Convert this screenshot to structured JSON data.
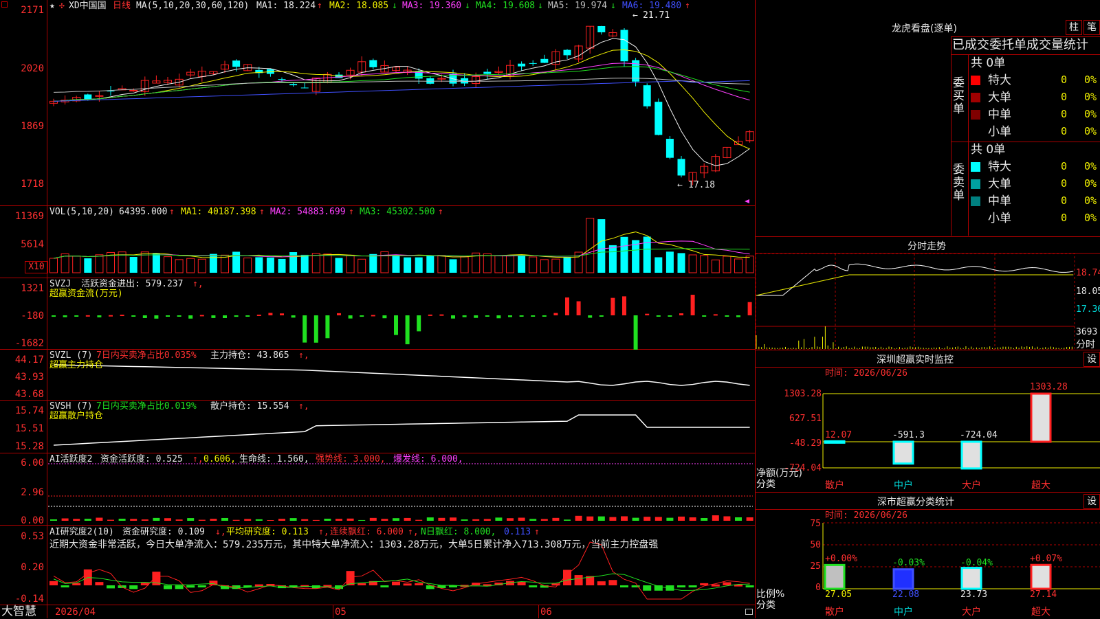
{
  "app_name": "大智慧",
  "main": {
    "header": {
      "star": "★",
      "cross": "✣",
      "stock": "XD中国国",
      "period": "日线",
      "ma_params": "MA(5,10,20,30,60,120)",
      "ma1": "MA1: 18.224",
      "ma1_arrow": "↑",
      "ma2": "MA2: 18.085",
      "ma2_arrow": "↓",
      "ma3": "MA3: 19.360",
      "ma3_arrow": "↓",
      "ma4": "MA4: 19.608",
      "ma4_arrow": "↓",
      "ma5": "MA5: 19.974",
      "ma5_arrow": "↓",
      "ma6": "MA6: 19.480",
      "ma6_arrow": "↑"
    },
    "price_ticks": [
      "2171",
      "2020",
      "1869",
      "1718"
    ],
    "high_label": "21.71",
    "low_label": "17.18",
    "low_arrow": "←",
    "high_arrow": "←"
  },
  "vol": {
    "header": "VOL(5,10,20)",
    "value": "64395.000",
    "ma1": "MA1: 40187.398",
    "ma2": "MA2: 54883.699",
    "ma3": "MA3: 45302.500",
    "ticks": [
      "11369",
      "5614"
    ],
    "unit": "X10"
  },
  "svzj": {
    "header": "SVZJ",
    "desc": "活跃资金进出: 579.237",
    "sub": "超赢资金流(万元)",
    "ticks": [
      "1321",
      "-180",
      "-1682"
    ]
  },
  "svzl": {
    "header": "SVZL (7)",
    "desc1": "7日内买卖净占比0.035%",
    "desc2": "主力持仓: 43.865",
    "sub": "超赢主力持仓",
    "ticks": [
      "44.17",
      "43.93",
      "43.68"
    ]
  },
  "svsh": {
    "header": "SVSH (7)",
    "desc1": "7日内买卖净占比0.019%",
    "desc2": "散户持仓: 15.554",
    "sub": "超赢散户持仓",
    "ticks": [
      "15.74",
      "15.51",
      "15.28"
    ]
  },
  "ai1": {
    "header": "AI活跃度2",
    "desc1": "资金活跃度: 0.525",
    "desc2": "0.606,",
    "desc3": "生命线: 1.560,",
    "desc4": "强势线: 3.000,",
    "desc5": "爆发线: 6.000,",
    "ticks": [
      "6.00",
      "2.96",
      "0.00"
    ]
  },
  "ai2": {
    "header": "AI研究度2(10)",
    "desc1": "资金研究度: 0.109",
    "desc2": "平均研究度: 0.113",
    "desc3": "连续飘红: 6.000",
    "desc4": "N日飘红: 8.000,",
    "desc5": "0.113",
    "comment": "近期大资金非常活跃，今日大单净流入：579.235万元，其中特大单净流入：1303.28万元，大单5日累计净入713.308万元，当前主力控盘强",
    "ticks": [
      "0.53",
      "0.20",
      "-0.14"
    ]
  },
  "x_axis": {
    "d1": "2026/04",
    "d2": "05",
    "d3": "06"
  },
  "right": {
    "lhb_title": "龙虎看盘(逐单)",
    "tab1": "柱",
    "tab2": "笔",
    "stats_title": "已成交委托单成交量统计",
    "buy_label": "委买单",
    "sell_label": "委卖单",
    "buy_total": "共 0单",
    "sell_total": "共 0单",
    "rows": [
      "特大",
      "大单",
      "中单",
      "小单"
    ],
    "zero": "0",
    "pct": "0%",
    "buy_colors": [
      "#ff0000",
      "#a00000",
      "#800000",
      "#000000"
    ],
    "sell_colors": [
      "#00ffff",
      "#00a0a0",
      "#008080",
      "#000000"
    ],
    "fs_title": "分时走势",
    "fs_ticks": [
      "18.74",
      "18.05",
      "17.36",
      "3693"
    ],
    "fs_unit": "分时",
    "monitor_title": "深圳超赢实时监控",
    "set": "设",
    "monitor_time": "时间: 2026/06/26",
    "monitor_ticks": [
      "1303.28",
      "627.51",
      "-48.29",
      "-724.04"
    ],
    "monitor_values": [
      "12.07",
      "-591.3",
      "-724.04",
      "1303.28"
    ],
    "monitor_values_num": [
      12.07,
      -591.3,
      -724.04,
      1303.28
    ],
    "monitor_ylabel": "净额(万元)",
    "cats_label": "分类",
    "cats": [
      "散户",
      "中户",
      "大户",
      "超大"
    ],
    "class_title": "深市超赢分类统计",
    "class_time": "时间: 2026/06/26",
    "class_ticks": [
      "75",
      "50",
      "25",
      "0"
    ],
    "class_pct": [
      "+0.00%",
      "-0.03%",
      "-0.04%",
      "+0.07%"
    ],
    "class_vals": [
      "27.05",
      "22.08",
      "23.73",
      "27.14"
    ],
    "class_vals_num": [
      27.05,
      22.08,
      23.73,
      27.14
    ],
    "class_ylabel": "比例%"
  }
}
